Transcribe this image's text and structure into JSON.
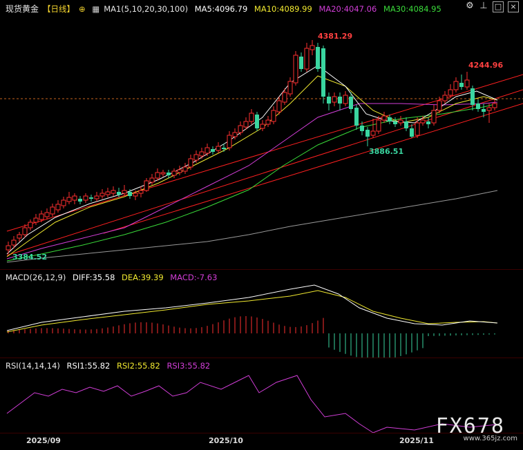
{
  "main": {
    "symbol": "现货黄金",
    "period": "【日线】",
    "ma_label": "MA1(5,10,20,30,100)",
    "ma5": "MA5:4096.79",
    "ma10": "MA10:4089.99",
    "ma20": "MA20:4047.06",
    "ma30": "MA30:4084.95",
    "high_label": "4381.29",
    "high2_label": "4244.96",
    "low_label": "3886.51",
    "low_start_label": "3384.52",
    "colors": {
      "ma5": "#ffffff",
      "ma10": "#f2ea30",
      "ma20": "#d23ed8",
      "ma30": "#3adc3a",
      "ma100": "#9a9a9a",
      "up": "#ff3030",
      "down": "#3ad6a0",
      "trend": "#ff2020"
    }
  },
  "macd": {
    "label": "MACD(26,12,9)",
    "diff": "DIFF:35.58",
    "dea": "DEA:39.39",
    "macd": "MACD:-7.63"
  },
  "rsi": {
    "label": "RSI(14,14,14)",
    "rsi1": "RSI1:55.82",
    "rsi2": "RSI2:55.82",
    "rsi3": "RSI3:55.82"
  },
  "time_axis": [
    "2025/09",
    "2025/10",
    "2025/11"
  ],
  "icons": [
    "settings-icon",
    "pin-icon",
    "maximize-icon",
    "close-icon"
  ],
  "watermark": "FX678",
  "watermark_url": "www.365jz.com"
}
